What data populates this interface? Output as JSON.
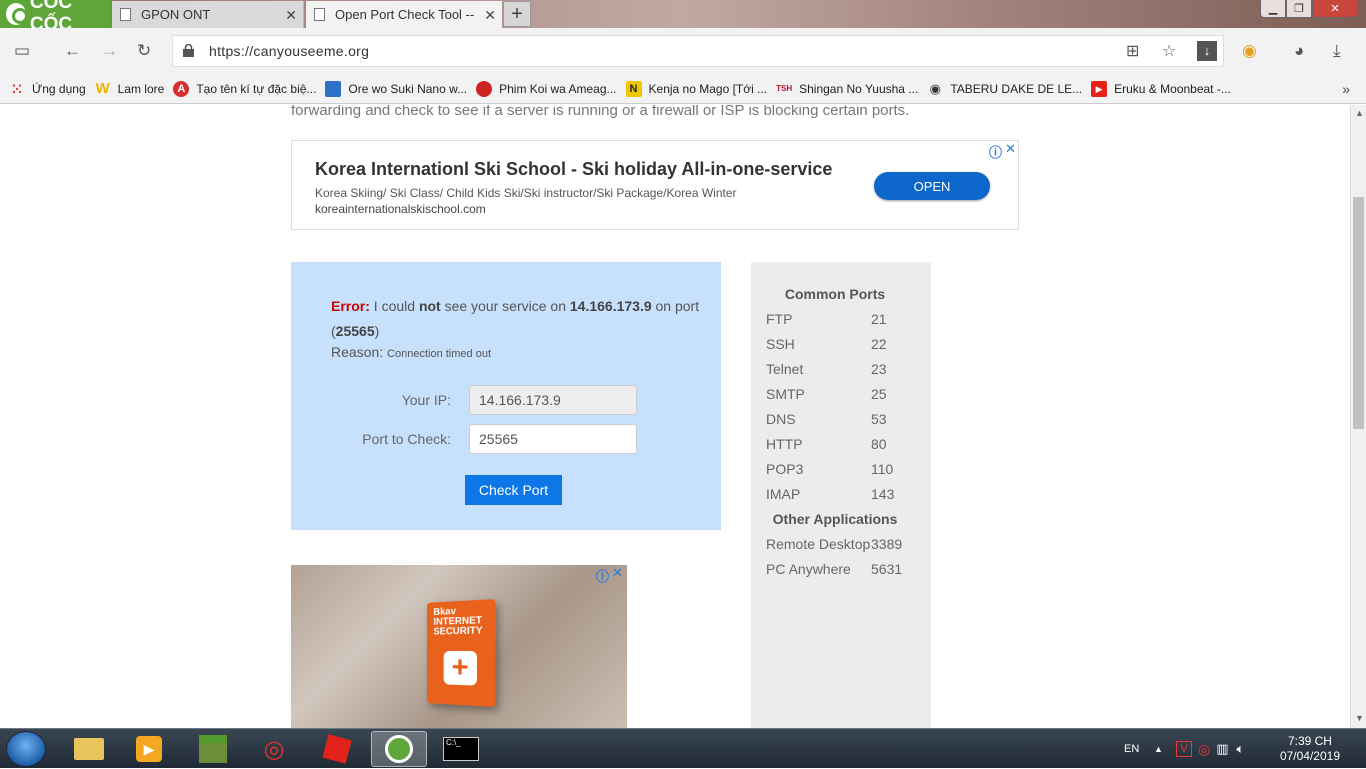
{
  "browser": {
    "brand": "CỐC CỐC",
    "tabs": [
      {
        "label": "GPON ONT"
      },
      {
        "label": "Open Port Check Tool -- \\"
      }
    ],
    "url": "https://canyouseeme.org",
    "bookmarks": [
      {
        "label": "Ứng dụng",
        "color": "#e9453b"
      },
      {
        "label": "Lam lore",
        "color": "#f1b500"
      },
      {
        "label": "Tạo tên kí tự đặc biệ...",
        "color": "#d62e2e"
      },
      {
        "label": "Ore wo Suki Nano w...",
        "color": "#2e6fc8"
      },
      {
        "label": "Phim Koi wa Ameag...",
        "color": "#c22"
      },
      {
        "label": "Kenja no Mago [Tới ...",
        "color": "#f0c800"
      },
      {
        "label": "Shingan No Yuusha ...",
        "color": "#b5122a"
      },
      {
        "label": "TABERU DAKE DE LE...",
        "color": "#333333"
      },
      {
        "label": "Eruku & Moonbeat -...",
        "color": "#e62117"
      }
    ]
  },
  "page": {
    "intro": "forwarding and check to see if a server is running or a firewall or ISP is blocking certain ports.",
    "ad_top": {
      "headline": "Korea Internationl Ski School - Ski holiday All-in-one-service",
      "description": "Korea Skiing/ Ski Class/ Child Kids Ski/Ski instructor/Ski Package/Korea Winter",
      "domain": "koreainternationalskischool.com",
      "button": "OPEN"
    },
    "checker": {
      "error_label": "Error:",
      "msg1": " I could ",
      "msg_not": "not",
      "msg2": " see your service on ",
      "ip": "14.166.173.9",
      "msg3": " on port (",
      "port": "25565",
      "msg4": ")",
      "reason_label": "Reason:",
      "reason_value": "Connection timed out",
      "your_ip_label": "Your IP:",
      "your_ip_value": "14.166.173.9",
      "port_label": "Port to Check:",
      "port_value": "25565",
      "button": "Check Port"
    },
    "ports": {
      "common_title": "Common Ports",
      "common": [
        {
          "name": "FTP",
          "port": "21"
        },
        {
          "name": "SSH",
          "port": "22"
        },
        {
          "name": "Telnet",
          "port": "23"
        },
        {
          "name": "SMTP",
          "port": "25"
        },
        {
          "name": "DNS",
          "port": "53"
        },
        {
          "name": "HTTP",
          "port": "80"
        },
        {
          "name": "POP3",
          "port": "110"
        },
        {
          "name": "IMAP",
          "port": "143"
        }
      ],
      "apps_title": "Other Applications",
      "apps": [
        {
          "name": "Remote Desktop",
          "port": "3389"
        },
        {
          "name": "PC Anywhere",
          "port": "5631"
        }
      ]
    },
    "ad_bottom": {
      "product_text": "Bkav INTERNET SECURITY"
    }
  },
  "taskbar": {
    "lang": "EN",
    "time": "7:39 CH",
    "date": "07/04/2019"
  }
}
